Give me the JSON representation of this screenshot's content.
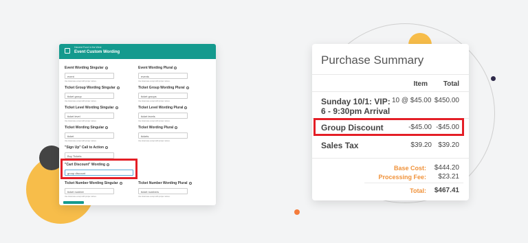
{
  "form": {
    "breadcrumb": "Harvest Fund in the West",
    "title": "Event Custom Wording",
    "helper": "Use lowercase except with proper names.",
    "fields": [
      {
        "label": "Event Wording Singular",
        "value": "event"
      },
      {
        "label": "Event Wording Plural",
        "value": "events"
      },
      {
        "label": "Ticket Group Wording Singular",
        "value": "ticket group"
      },
      {
        "label": "Ticket Group Wording Plural",
        "value": "ticket groups"
      },
      {
        "label": "Ticket Level Wording Singular",
        "value": "ticket level"
      },
      {
        "label": "Ticket Level Wording Plural",
        "value": "ticket levels"
      },
      {
        "label": "Ticket Wording Singular",
        "value": "ticket"
      },
      {
        "label": "Ticket Wording Plural",
        "value": "tickets"
      },
      {
        "label": "\"Sign Up\" Call to Action",
        "value": "Buy Tickets"
      },
      {
        "label": "\"Cart Discount\" Wording",
        "value": "group discount"
      },
      {
        "label": "Ticket Number Wording Singular",
        "value": "ticket number"
      },
      {
        "label": "Ticket Number Wording Plural",
        "value": "ticket numbers"
      }
    ],
    "accent": "#149a8e"
  },
  "summary": {
    "title": "Purchase Summary",
    "col_item": "Item",
    "col_total": "Total",
    "rows": [
      {
        "name": "Sunday 10/1: VIP: 6 - 9:30pm Arrival",
        "item": "10 @ $45.00",
        "total": "$450.00"
      },
      {
        "name": "Group Discount",
        "item": "-$45.00",
        "total": "-$45.00"
      },
      {
        "name": "Sales Tax",
        "item": "$39.20",
        "total": "$39.20"
      }
    ],
    "base_cost_label": "Base Cost:",
    "base_cost": "$444.20",
    "processing_fee_label": "Processing Fee:",
    "processing_fee": "$23.21",
    "total_label": "Total:",
    "total": "$467.41",
    "highlight_color": "#e41e26",
    "orange_color": "#f0923a"
  }
}
